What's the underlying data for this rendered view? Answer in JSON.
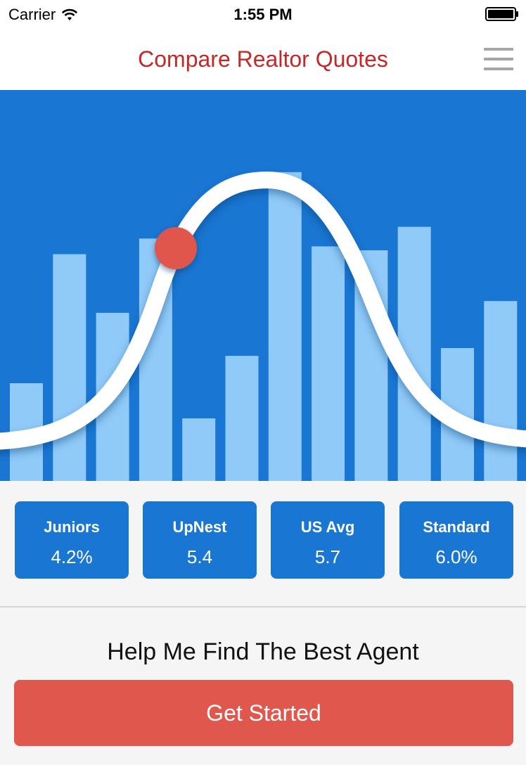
{
  "status_bar": {
    "carrier": "Carrier",
    "time": "1:55 PM"
  },
  "header": {
    "title": "Compare Realtor Quotes",
    "menu_icon": "hamburger-menu-icon",
    "title_color": "#c62828"
  },
  "hero": {
    "background_color": "#1976d2",
    "bar_color": "#90caf9",
    "curve_color": "#ffffff",
    "marker_color": "#e0574e",
    "bar_heights": [
      0.25,
      0.58,
      0.43,
      0.62,
      0.16,
      0.32,
      0.79,
      0.6,
      0.59,
      0.65,
      0.34,
      0.46
    ]
  },
  "stats": [
    {
      "label": "Juniors",
      "value": "4.2%"
    },
    {
      "label": "UpNest",
      "value": "5.4"
    },
    {
      "label": "US Avg",
      "value": "5.7"
    },
    {
      "label": "Standard",
      "value": "6.0%"
    }
  ],
  "cta": {
    "heading": "Help Me Find The Best Agent",
    "button_label": "Get Started",
    "button_color": "#e0574e"
  }
}
